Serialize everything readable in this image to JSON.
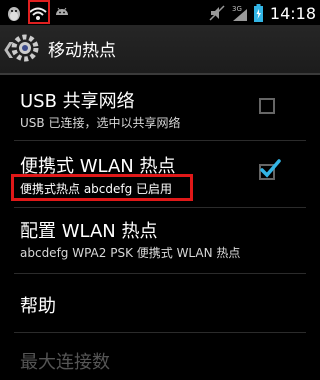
{
  "statusbar": {
    "time": "14:18",
    "network_label": "3G",
    "icons": [
      "qq-penguin-icon",
      "wifi-hotspot-icon",
      "android-icon",
      "mute-icon",
      "signal-icon",
      "battery-icon"
    ]
  },
  "actionbar": {
    "title": "移动热点",
    "icon": "settings-icon"
  },
  "preferences": [
    {
      "title": "USB 共享网络",
      "summary": "USB 已连接，选中以共享网络",
      "checked": false
    },
    {
      "title": "便携式 WLAN 热点",
      "summary": "便携式热点 abcdefg 已启用",
      "checked": true
    },
    {
      "title": "配置 WLAN 热点",
      "summary": "abcdefg WPA2 PSK 便携式 WLAN 热点"
    },
    {
      "title": "帮助"
    },
    {
      "title": "最大连接数",
      "enabled": false
    }
  ],
  "colors": {
    "highlight": "#e01818",
    "check_accent": "#33b5e5",
    "background": "#000000"
  }
}
